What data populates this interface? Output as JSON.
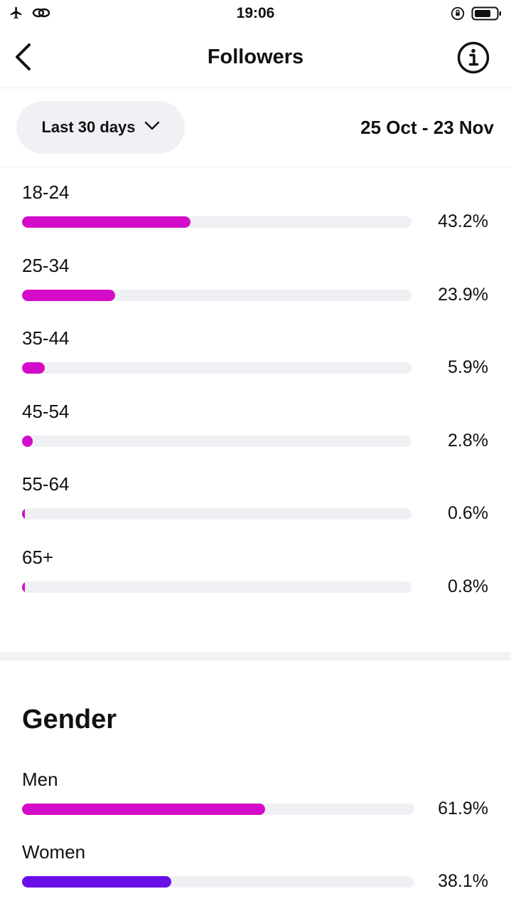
{
  "status_bar": {
    "time": "19:06",
    "icons": [
      "airplane-icon",
      "link-icon",
      "rotation-lock-icon",
      "battery-icon"
    ]
  },
  "header": {
    "title": "Followers",
    "back_icon": "chevron-left-icon",
    "info_icon": "info-icon"
  },
  "filter": {
    "range_label": "Last 30 days",
    "range_icon": "chevron-down-icon",
    "date_range": "25 Oct - 23 Nov"
  },
  "colors": {
    "accent_magenta": "#d40bc8",
    "accent_purple": "#6a0ee6",
    "track_gray": "#eff0f3"
  },
  "age_ranges": [
    {
      "label": "18-24",
      "percent_text": "43.2%",
      "value": 43.2
    },
    {
      "label": "25-34",
      "percent_text": "23.9%",
      "value": 23.9
    },
    {
      "label": "35-44",
      "percent_text": "5.9%",
      "value": 5.9
    },
    {
      "label": "45-54",
      "percent_text": "2.8%",
      "value": 2.8
    },
    {
      "label": "55-64",
      "percent_text": "0.6%",
      "value": 0.6
    },
    {
      "label": "65+",
      "percent_text": "0.8%",
      "value": 0.8
    }
  ],
  "gender": {
    "title": "Gender",
    "items": [
      {
        "label": "Men",
        "percent_text": "61.9%",
        "value": 61.9
      },
      {
        "label": "Women",
        "percent_text": "38.1%",
        "value": 38.1
      }
    ]
  }
}
